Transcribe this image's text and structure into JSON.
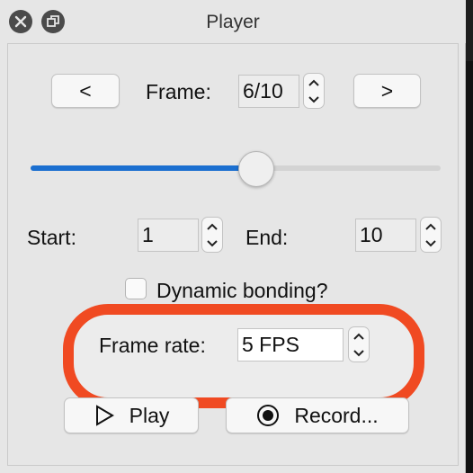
{
  "window": {
    "title": "Player"
  },
  "frame": {
    "prev_label": "<",
    "next_label": ">",
    "label": "Frame:",
    "value": "6/10",
    "slider_fraction": 0.55
  },
  "range": {
    "start_label": "Start:",
    "start_value": "1",
    "end_label": "End:",
    "end_value": "10"
  },
  "options": {
    "dynamic_bonding_label": "Dynamic bonding?",
    "dynamic_bonding_checked": false
  },
  "frame_rate": {
    "label": "Frame rate:",
    "value": "5 FPS"
  },
  "actions": {
    "play_label": "Play",
    "record_label": "Record..."
  },
  "colors": {
    "slider_fill": "#1b6fd0",
    "highlight_ring": "#f04a22"
  },
  "icons": {
    "close": "close-icon",
    "restore": "restore-icon",
    "play": "play-icon",
    "record": "record-icon"
  }
}
